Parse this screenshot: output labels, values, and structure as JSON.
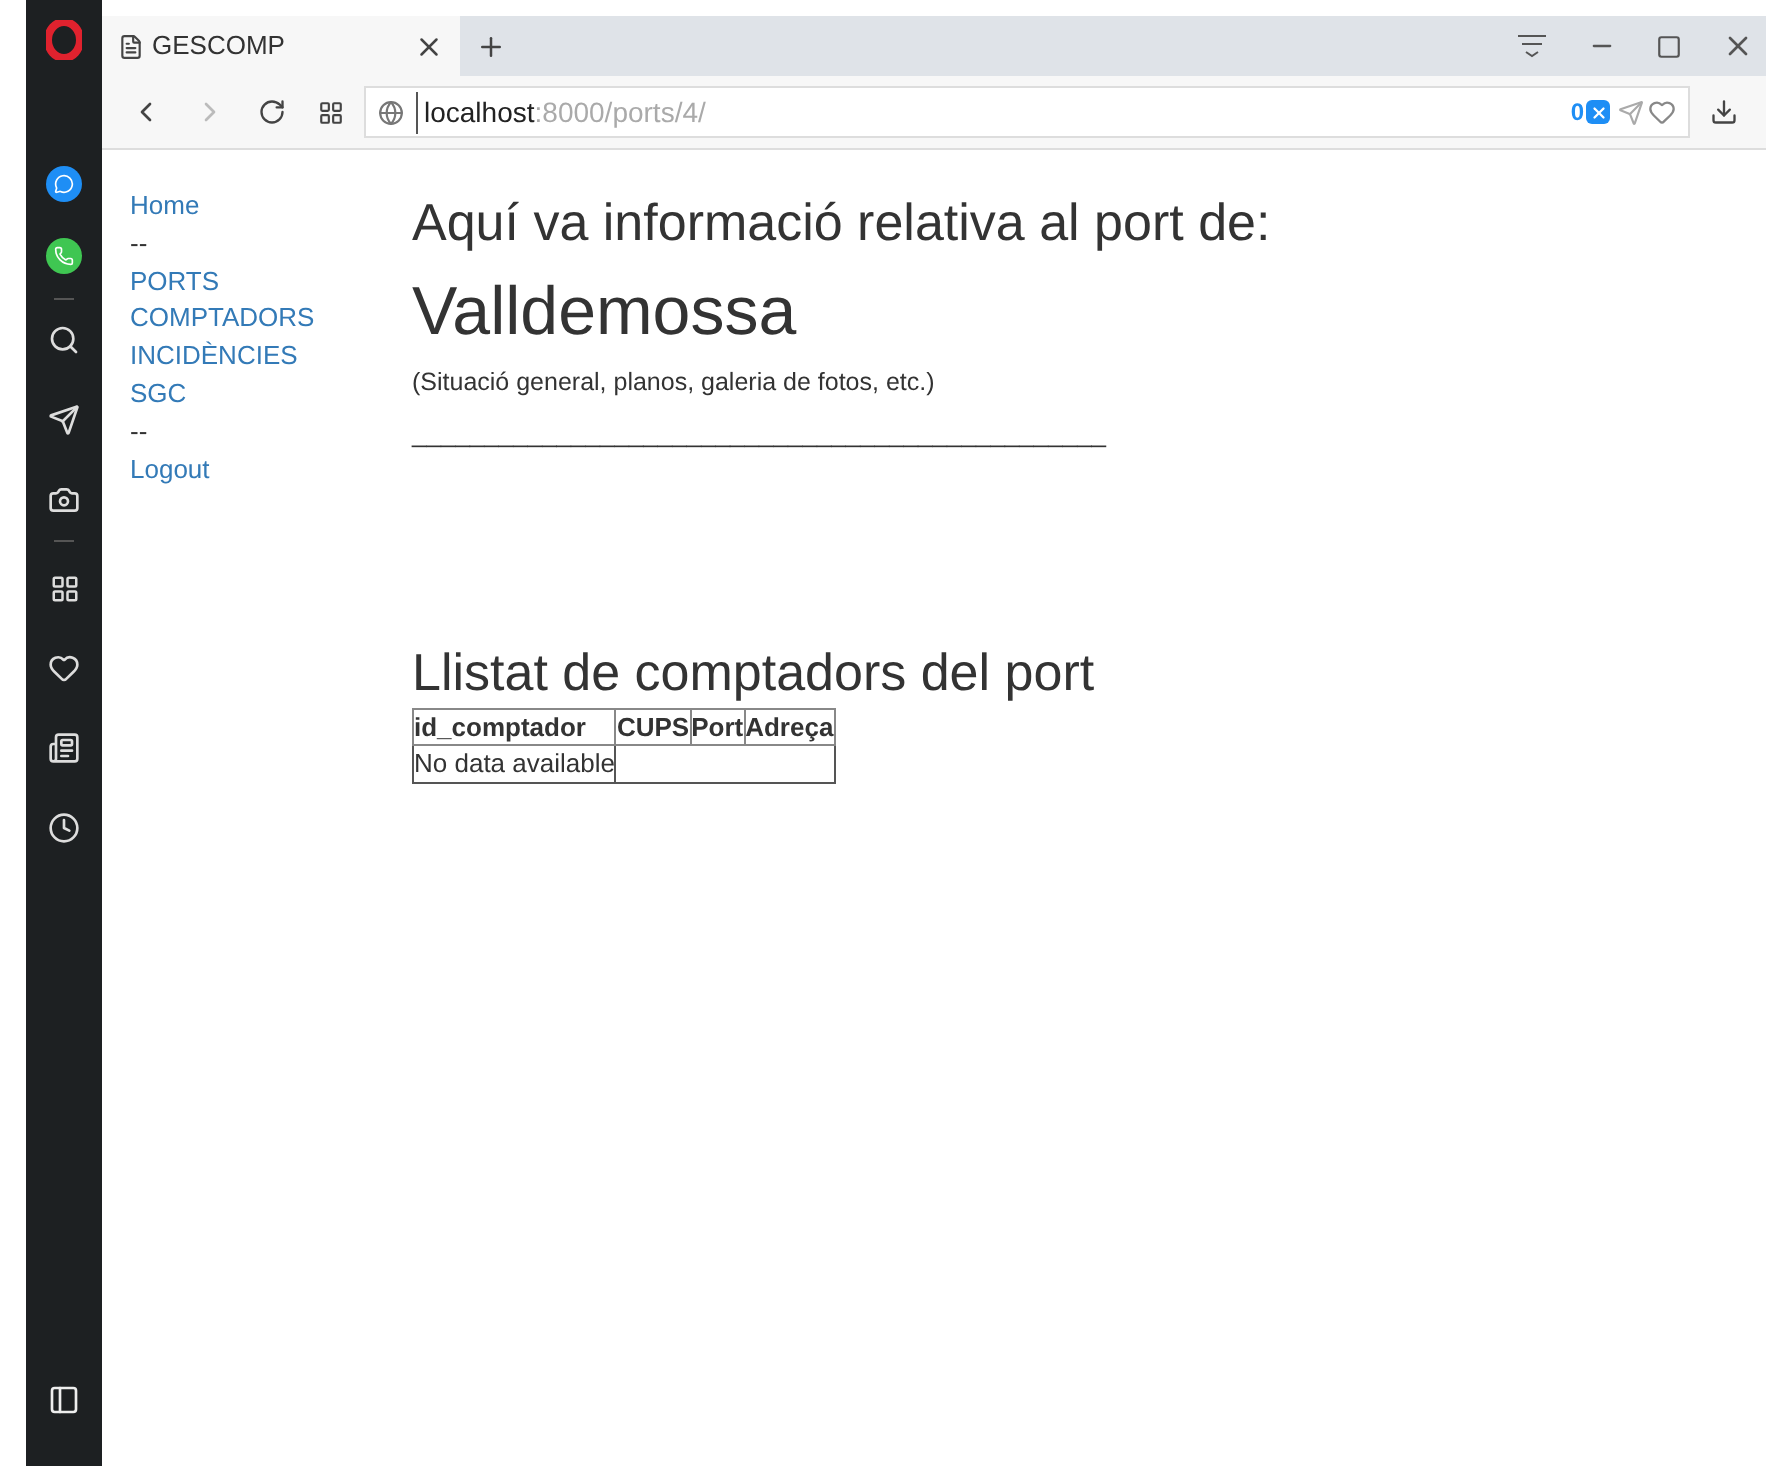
{
  "browser": {
    "tab_title": "GESCOMP",
    "url_host": "localhost",
    "url_path": ":8000/ports/4/",
    "blocked_count": "0"
  },
  "nav": [
    {
      "kind": "link",
      "label": "Home"
    },
    {
      "kind": "separator",
      "label": "--"
    },
    {
      "kind": "link",
      "label": "PORTS"
    },
    {
      "kind": "link",
      "label": "COMPTADORS"
    },
    {
      "kind": "link",
      "label": "INCIDÈNCIES"
    },
    {
      "kind": "link",
      "label": "SGC"
    },
    {
      "kind": "separator",
      "label": "--"
    },
    {
      "kind": "link",
      "label": "Logout"
    }
  ],
  "heading": "Aquí va informació relativa al port de:",
  "port_name": "Valldemossa",
  "description": "(Situació general, planos, galeria de fotos, etc.)",
  "separator_line": "________________________________________________",
  "table": {
    "title": "Llistat de comptadors del port",
    "columns": [
      "id_comptador",
      "CUPS",
      "Port",
      "Adreça"
    ],
    "empty_message": "No data available"
  }
}
